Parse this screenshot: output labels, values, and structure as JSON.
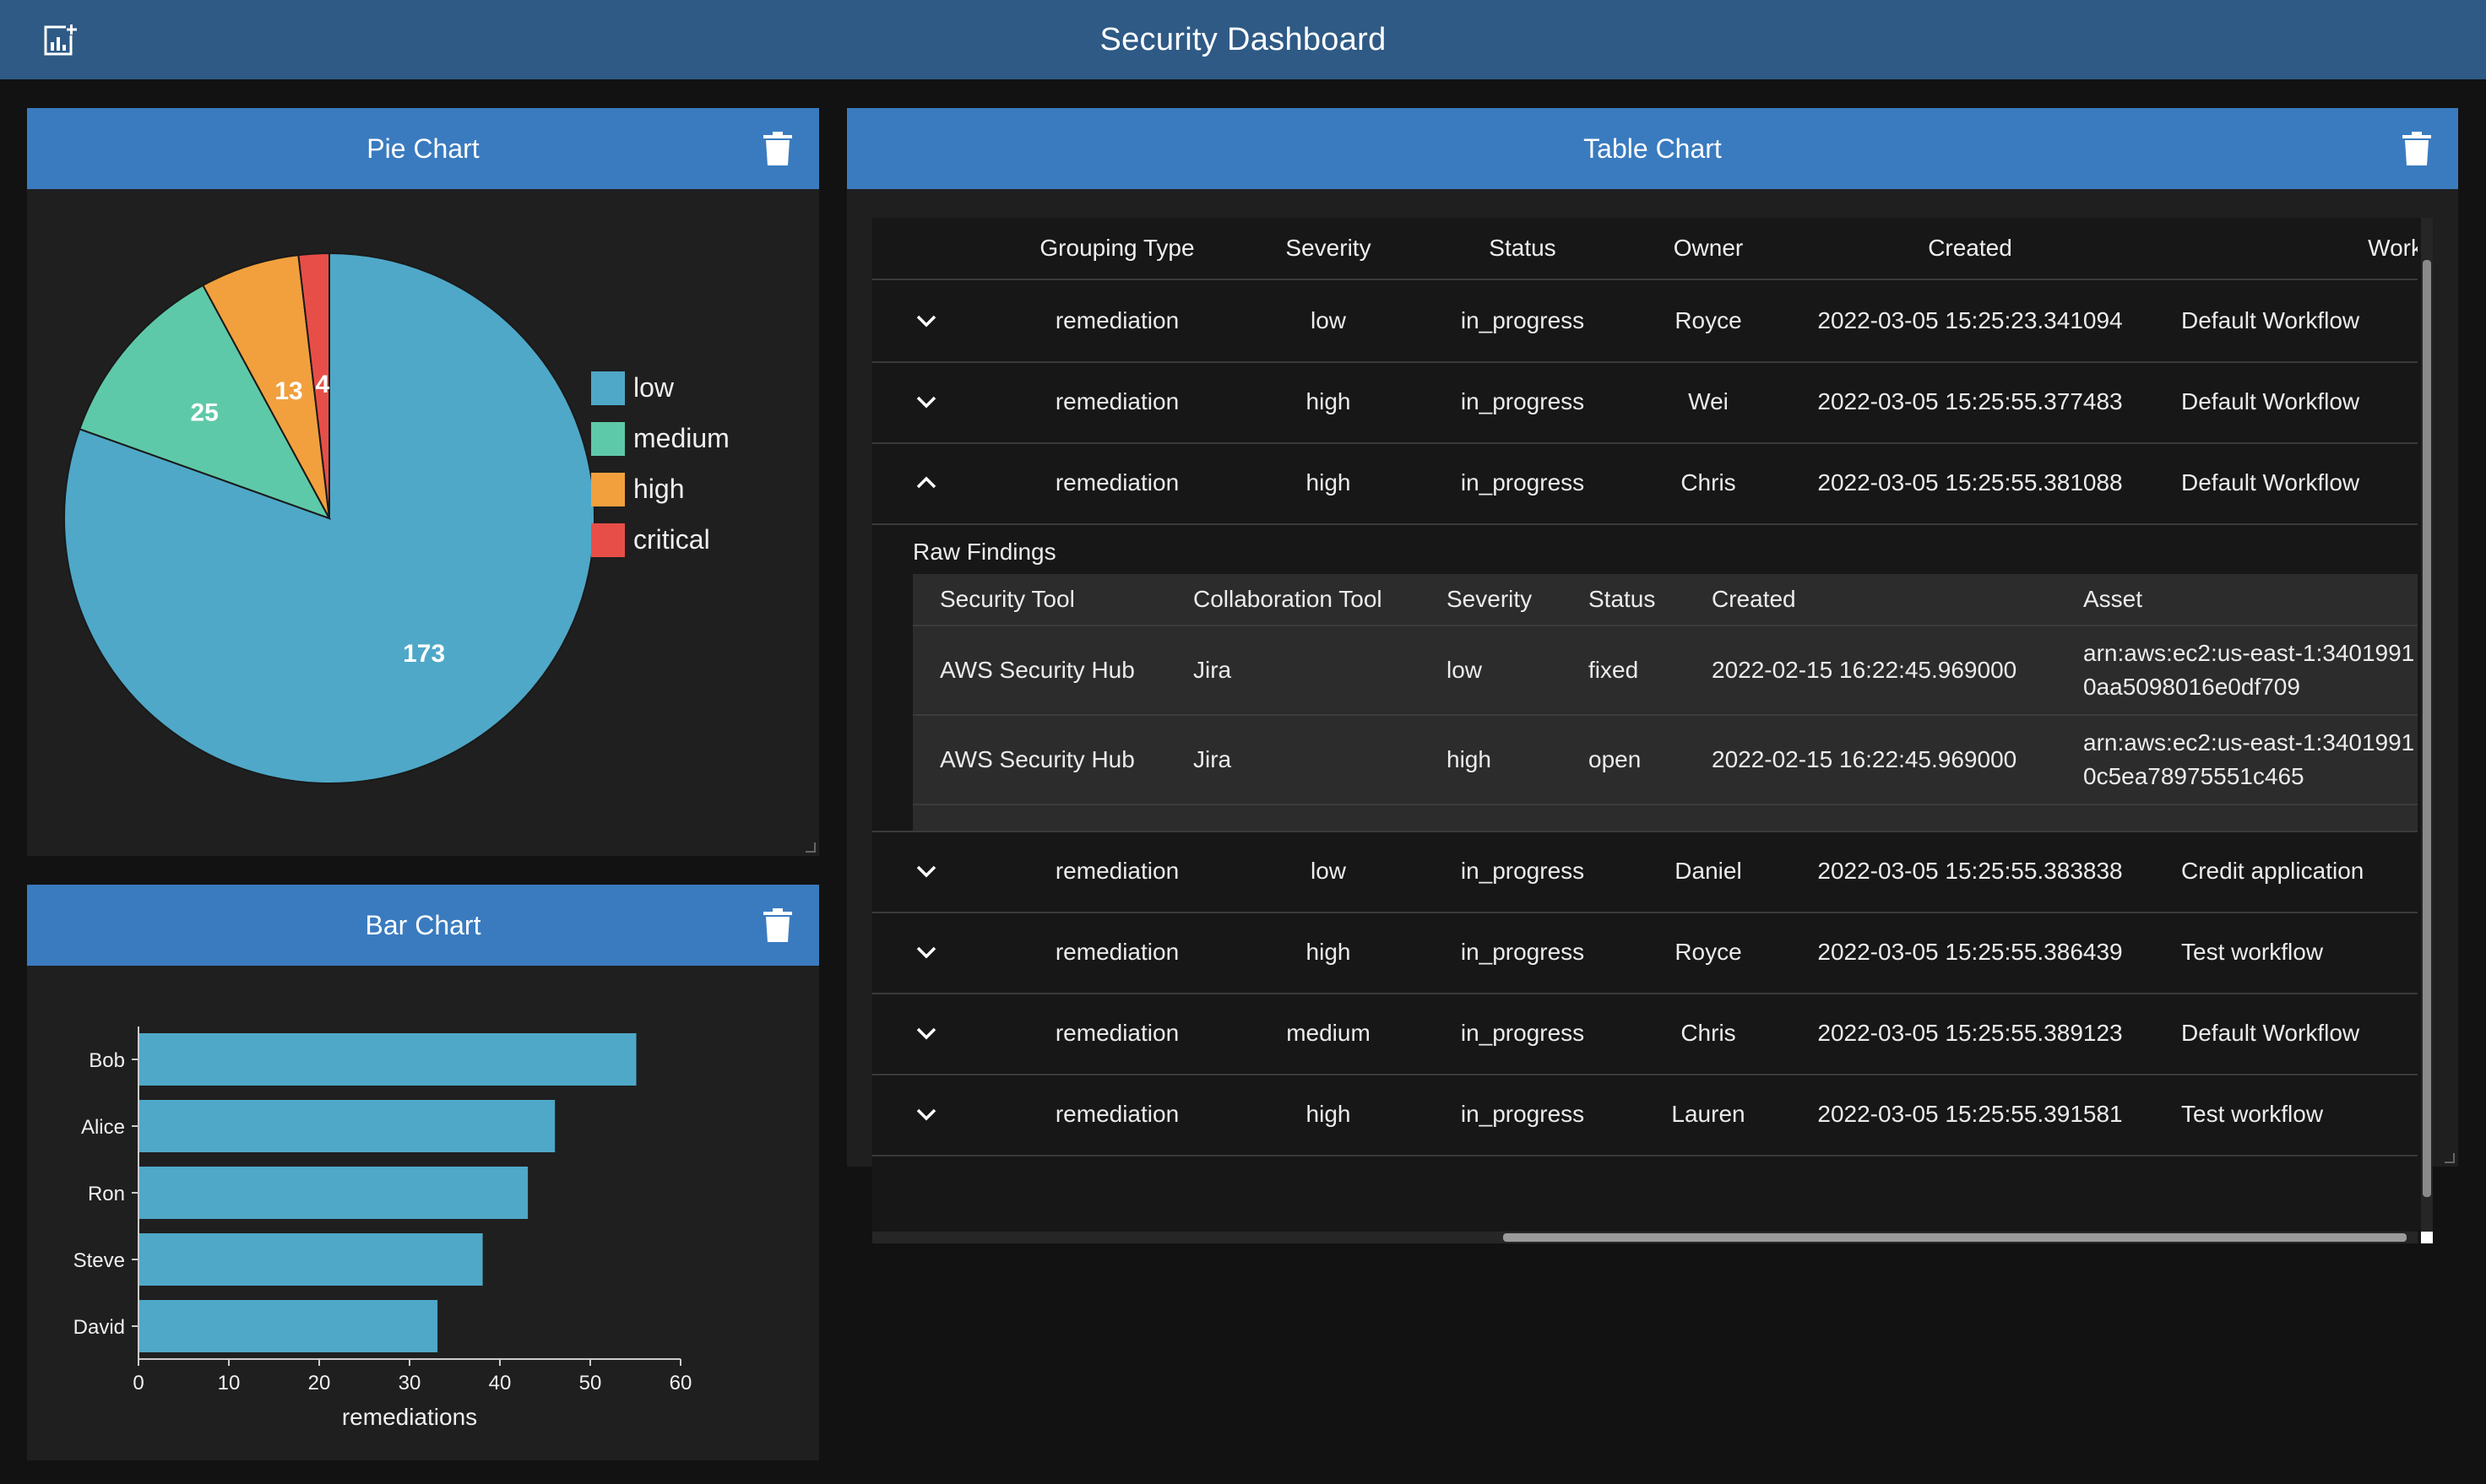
{
  "app": {
    "title": "Security Dashboard",
    "add_chart_icon": "add-chart-icon"
  },
  "pie_panel": {
    "title": "Pie Chart",
    "delete_icon": "trash-icon"
  },
  "bar_panel": {
    "title": "Bar Chart",
    "delete_icon": "trash-icon"
  },
  "table_panel": {
    "title": "Table Chart",
    "delete_icon": "trash-icon",
    "columns": [
      "Grouping Type",
      "Severity",
      "Status",
      "Owner",
      "Created",
      "Workfl"
    ],
    "rows": [
      {
        "expanded": false,
        "grouping_type": "remediation",
        "severity": "low",
        "status": "in_progress",
        "owner": "Royce",
        "created": "2022-03-05 15:25:23.341094",
        "workflow": "Default Workflow"
      },
      {
        "expanded": false,
        "grouping_type": "remediation",
        "severity": "high",
        "status": "in_progress",
        "owner": "Wei",
        "created": "2022-03-05 15:25:55.377483",
        "workflow": "Default Workflow"
      },
      {
        "expanded": true,
        "grouping_type": "remediation",
        "severity": "high",
        "status": "in_progress",
        "owner": "Chris",
        "created": "2022-03-05 15:25:55.381088",
        "workflow": "Default Workflow"
      },
      {
        "expanded": false,
        "grouping_type": "remediation",
        "severity": "low",
        "status": "in_progress",
        "owner": "Daniel",
        "created": "2022-03-05 15:25:55.383838",
        "workflow": "Credit application"
      },
      {
        "expanded": false,
        "grouping_type": "remediation",
        "severity": "high",
        "status": "in_progress",
        "owner": "Royce",
        "created": "2022-03-05 15:25:55.386439",
        "workflow": "Test workflow"
      },
      {
        "expanded": false,
        "grouping_type": "remediation",
        "severity": "medium",
        "status": "in_progress",
        "owner": "Chris",
        "created": "2022-03-05 15:25:55.389123",
        "workflow": "Default Workflow"
      },
      {
        "expanded": false,
        "grouping_type": "remediation",
        "severity": "high",
        "status": "in_progress",
        "owner": "Lauren",
        "created": "2022-03-05 15:25:55.391581",
        "workflow": "Test workflow"
      }
    ],
    "raw_findings": {
      "title": "Raw Findings",
      "columns": [
        "Security Tool",
        "Collaboration Tool",
        "Severity",
        "Status",
        "Created",
        "Asset"
      ],
      "rows": [
        {
          "security_tool": "AWS Security Hub",
          "collaboration_tool": "Jira",
          "severity": "low",
          "status": "fixed",
          "created": "2022-02-15 16:22:45.969000",
          "asset_line1": "arn:aws:ec2:us-east-1:3401991",
          "asset_line2": "0aa5098016e0df709"
        },
        {
          "security_tool": "AWS Security Hub",
          "collaboration_tool": "Jira",
          "severity": "high",
          "status": "open",
          "created": "2022-02-15 16:22:45.969000",
          "asset_line1": "arn:aws:ec2:us-east-1:3401991",
          "asset_line2": "0c5ea78975551c465"
        }
      ]
    }
  },
  "chart_data": [
    {
      "type": "pie",
      "title": "",
      "categories": [
        "low",
        "medium",
        "high",
        "critical"
      ],
      "values": [
        173,
        25,
        13,
        4
      ],
      "colors": [
        "#4fa8c8",
        "#5ec9a8",
        "#f2a03d",
        "#e84e48"
      ],
      "legend": "right"
    },
    {
      "type": "bar",
      "orientation": "horizontal",
      "title": "",
      "categories": [
        "Bob",
        "Alice",
        "Ron",
        "Steve",
        "David"
      ],
      "values": [
        55,
        46,
        43,
        38,
        33
      ],
      "xlabel": "remediations",
      "ylabel": "",
      "xlim": [
        0,
        60
      ],
      "xticks": [
        "0",
        "10",
        "20",
        "30",
        "40",
        "50",
        "60"
      ],
      "color": "#4fa8c8",
      "grid": false
    }
  ]
}
